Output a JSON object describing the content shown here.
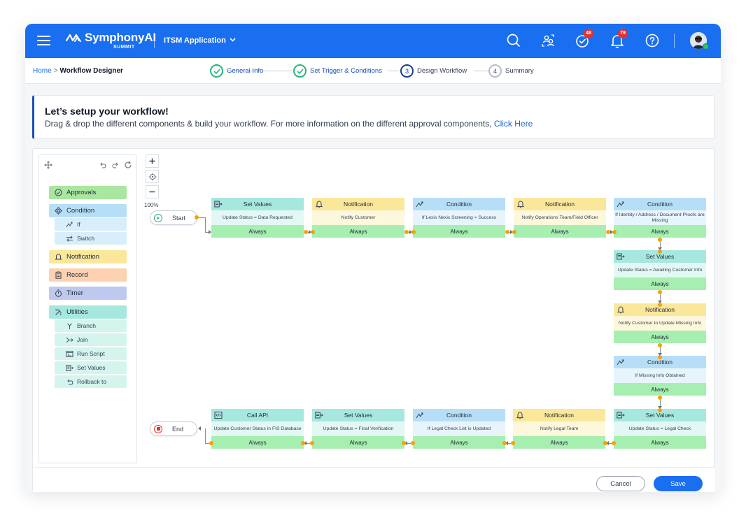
{
  "header": {
    "brand_name": "SymphonyAI",
    "brand_sub": "SUMMIT",
    "app_name": "ITSM Application",
    "approvals_badge": "48",
    "notifications_badge": "79",
    "icons": [
      "search-icon",
      "user-switch-icon",
      "approvals-icon",
      "bell-icon",
      "help-icon",
      "avatar"
    ]
  },
  "breadcrumb": {
    "home": "Home",
    "separator": ">",
    "current": "Workflow Designer"
  },
  "steps": [
    {
      "number": "1",
      "label": "General Info",
      "state": "done"
    },
    {
      "number": "2",
      "label": "Set Trigger & Conditions",
      "state": "done"
    },
    {
      "number": "3",
      "label": "Design Workflow",
      "state": "active"
    },
    {
      "number": "4",
      "label": "Summary",
      "state": "todo"
    }
  ],
  "intro": {
    "title": "Let’s setup your workflow!",
    "description": "Drag & drop the different components & build your workflow. For more information on the different approval components, ",
    "link": "Click Here"
  },
  "palette": {
    "items": {
      "approvals": "Approvals",
      "condition": "Condition",
      "if": "If",
      "switch": "Switch",
      "notification": "Notification",
      "record": "Record",
      "timer": "Timer",
      "utilities": "Utilities",
      "branch": "Branch",
      "join": "Join",
      "run_script": "Run Script",
      "set_values": "Set Values",
      "rollback_to": "Rollback to"
    },
    "colors": {
      "approvals": "#a9e6a0",
      "condition": "#b6def7",
      "notification": "#fbe79a",
      "record": "#fcd2b0",
      "timer": "#bfc9ef",
      "utilities": "#a6e8de"
    }
  },
  "zoom": {
    "level": "100%"
  },
  "workflow": {
    "start_label": "Start",
    "end_label": "End",
    "nodes": {
      "n1": {
        "type": "Set Values",
        "body": "Update Status = Data Requested",
        "footer": "Always"
      },
      "n2": {
        "type": "Notification",
        "body": "Notify Customer",
        "footer": "Always"
      },
      "n3": {
        "type": "Condition",
        "body": "If Lexis Nexis Screening = Success",
        "footer": "Always"
      },
      "n4": {
        "type": "Notification",
        "body": "Notify Operations Team/Field Officer",
        "footer": "Always"
      },
      "n5": {
        "type": "Condition",
        "body": "If Identity / Address / Document Proofs are Missing",
        "footer": "Always"
      },
      "n6": {
        "type": "Set Values",
        "body": "Update Status = Awaiting Customer Info",
        "footer": "Always"
      },
      "n7": {
        "type": "Notification",
        "body": "Notify Customer to Update Missing Info",
        "footer": "Always"
      },
      "n8": {
        "type": "Condition",
        "body": "If Missing Info Obtained",
        "footer": "Always"
      },
      "n9": {
        "type": "Set Values",
        "body": "Update Status = Legal Check",
        "footer": "Always"
      },
      "n10": {
        "type": "Notification",
        "body": "Notify Legal Team",
        "footer": "Always"
      },
      "n11": {
        "type": "Condition",
        "body": "If Legal Check List is Updated",
        "footer": "Always"
      },
      "n12": {
        "type": "Set Values",
        "body": "Update Status = Final Verification",
        "footer": "Always"
      },
      "n13": {
        "type": "Call API",
        "body": "Update Customer Status in FIS Database",
        "footer": "Always"
      }
    }
  },
  "footer": {
    "cancel": "Cancel",
    "save": "Save"
  },
  "colors": {
    "brand": "#1a6ef0",
    "step_done": "#2bb37e",
    "step_active": "#1b3a9a",
    "always_bar": "#a7efb0",
    "connector_dot": "#f5a20a"
  }
}
